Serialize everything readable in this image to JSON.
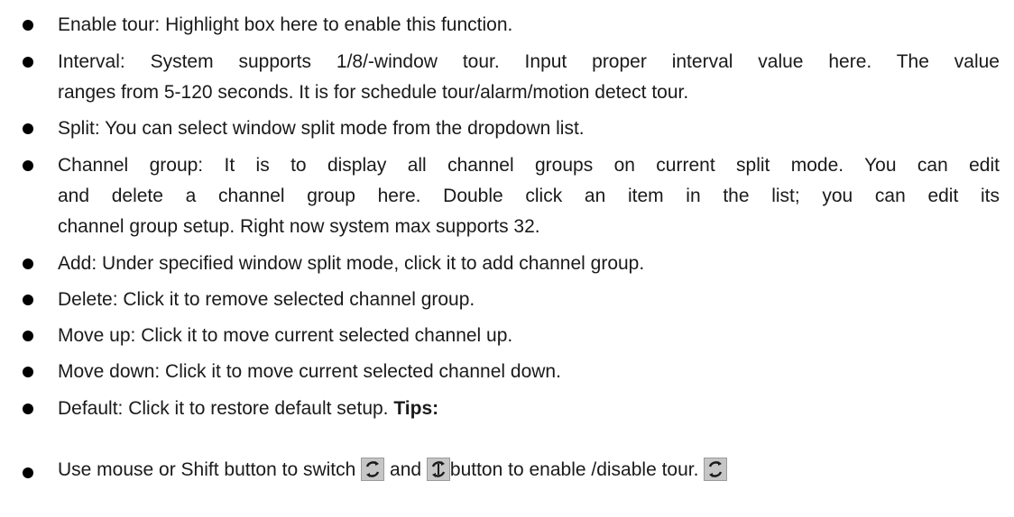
{
  "bullets": [
    {
      "lines": [
        "Enable tour: Highlight box here to enable this function."
      ]
    },
    {
      "lines": [
        "Interval: System supports 1/8/-window tour. Input proper interval value here. The value",
        "ranges from 5-120 seconds. It is for schedule tour/alarm/motion detect tour."
      ]
    },
    {
      "lines": [
        "Split: You can select window split mode from the dropdown list."
      ]
    },
    {
      "lines": [
        "Channel group: It is to display all channel groups on current split mode. You can edit",
        "and delete a channel group here. Double click an item in the list; you can edit its",
        "channel group setup. Right now system max supports 32."
      ]
    },
    {
      "lines": [
        "Add: Under specified window split mode, click it to add channel group."
      ]
    },
    {
      "lines": [
        "Delete: Click it to remove selected channel group."
      ]
    },
    {
      "lines": [
        "Move up: Click it to move current selected channel up."
      ]
    },
    {
      "lines": [
        "Move down: Click it to move current selected channel down."
      ]
    },
    {
      "text": "Default: Click it to restore default setup.",
      "bold": "Tips:"
    },
    {
      "part1": "Use mouse or Shift button to switch",
      "part2": "and",
      "part3": "button to enable /disable tour.",
      "icons": [
        "tour-enabled-icon",
        "tour-disabled-icon",
        "tour-enabled-icon"
      ]
    }
  ],
  "colors": {
    "text": "#1a1a1a",
    "bullet": "#000000",
    "icon_bg": "#c6c6c6",
    "icon_stroke": "#1a1a1a"
  }
}
